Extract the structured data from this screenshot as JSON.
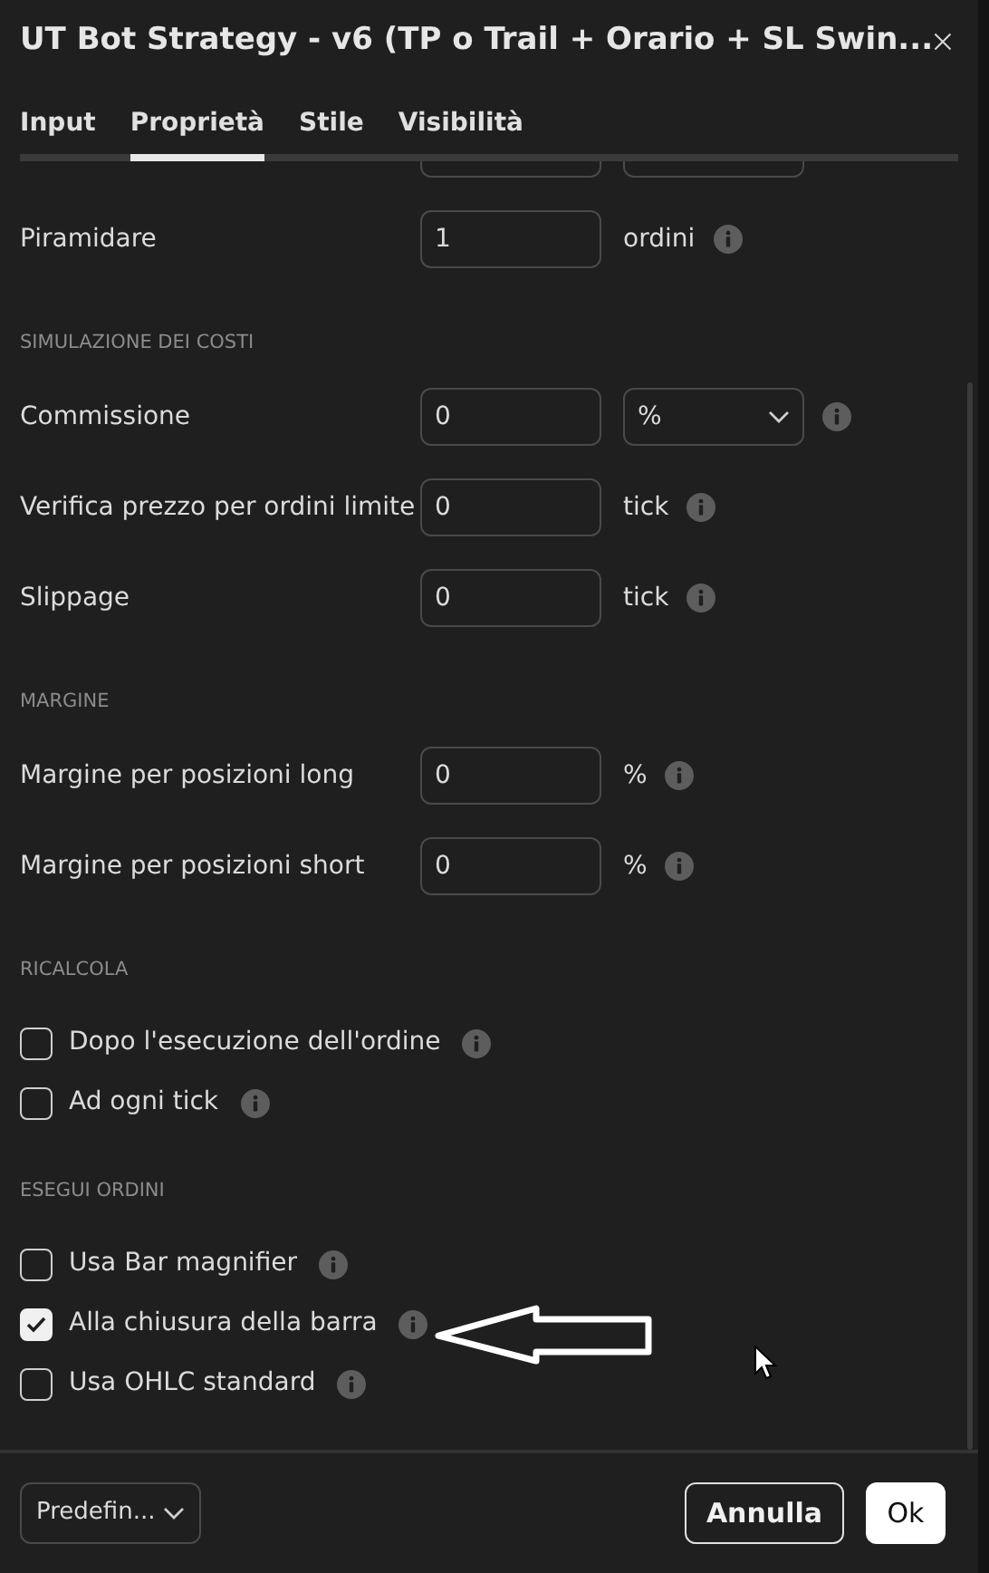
{
  "dialog": {
    "title": "UT Bot Strategy - v6 (TP o Trail + Orario + SL Swin...",
    "tabs": [
      {
        "label": "Input",
        "selected": false
      },
      {
        "label": "Proprietà",
        "selected": true
      },
      {
        "label": "Stile",
        "selected": false
      },
      {
        "label": "Visibilità",
        "selected": false
      }
    ],
    "sections": [
      {
        "rows": [
          {
            "kind": "input",
            "label": "Piramidare",
            "value": "1",
            "unit": "ordini"
          }
        ]
      },
      {
        "heading": "SIMULAZIONE DEI COSTI",
        "rows": [
          {
            "kind": "select",
            "label": "Commissione",
            "value": "0",
            "option": "%"
          },
          {
            "kind": "input",
            "label": "Verifica prezzo per ordini limite",
            "value": "0",
            "unit": "tick"
          },
          {
            "kind": "input",
            "label": "Slippage",
            "value": "0",
            "unit": "tick"
          }
        ]
      },
      {
        "heading": "MARGINE",
        "rows": [
          {
            "kind": "input",
            "label": "Margine per posizioni long",
            "value": "0",
            "unit": "%"
          },
          {
            "kind": "input",
            "label": "Margine per posizioni short",
            "value": "0",
            "unit": "%"
          }
        ]
      },
      {
        "heading": "RICALCOLA",
        "rows": [
          {
            "kind": "checkbox",
            "label": "Dopo l'esecuzione dell'ordine",
            "checked": false
          },
          {
            "kind": "checkbox",
            "label": "Ad ogni tick",
            "checked": false
          }
        ]
      },
      {
        "heading": "ESEGUI ORDINI",
        "rows": [
          {
            "kind": "checkbox",
            "label": "Usa Bar magnifier",
            "checked": false
          },
          {
            "kind": "checkbox",
            "label": "Alla chiusura della barra",
            "checked": true
          },
          {
            "kind": "checkbox",
            "label": "Usa OHLC standard",
            "checked": false
          }
        ]
      }
    ],
    "footer": {
      "preset": "Predefin...",
      "buttons": [
        {
          "label": "Annulla",
          "kind": "secondary"
        },
        {
          "label": "Ok",
          "kind": "primary"
        }
      ]
    }
  }
}
